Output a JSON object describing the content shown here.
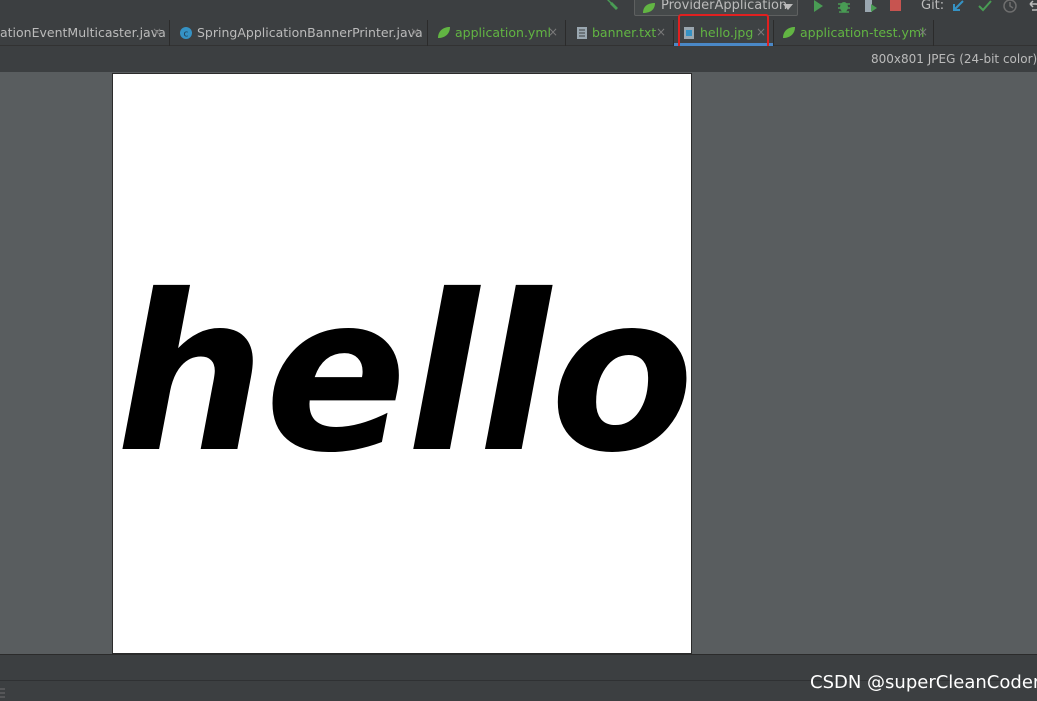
{
  "toolbar": {
    "run_config": "ProviderApplication",
    "vcs_label": "Git:"
  },
  "tabs": [
    {
      "label": "ationEventMulticaster.java",
      "color": "#bbbbbb",
      "icon": "java-class-icon",
      "active": false
    },
    {
      "label": "SpringApplicationBannerPrinter.java",
      "color": "#bbbbbb",
      "icon": "java-class-icon",
      "active": false
    },
    {
      "label": "application.yml",
      "color": "#62b543",
      "icon": "spring-leaf-icon",
      "active": false
    },
    {
      "label": "banner.txt",
      "color": "#62b543",
      "icon": "text-file-icon",
      "active": false
    },
    {
      "label": "hello.jpg",
      "color": "#62b543",
      "icon": "image-file-icon",
      "active": true
    },
    {
      "label": "application-test.yml",
      "color": "#62b543",
      "icon": "spring-leaf-icon",
      "active": false
    }
  ],
  "tab_close_glyph": "×",
  "image_info": "800x801 JPEG (24-bit color) :",
  "image_content_text": "hello",
  "watermark": "CSDN @superCleanCoder",
  "colors": {
    "accent": "#4a88c7",
    "highlight_box": "#e02020",
    "run_green": "#499c54",
    "stop_red": "#c75450"
  }
}
